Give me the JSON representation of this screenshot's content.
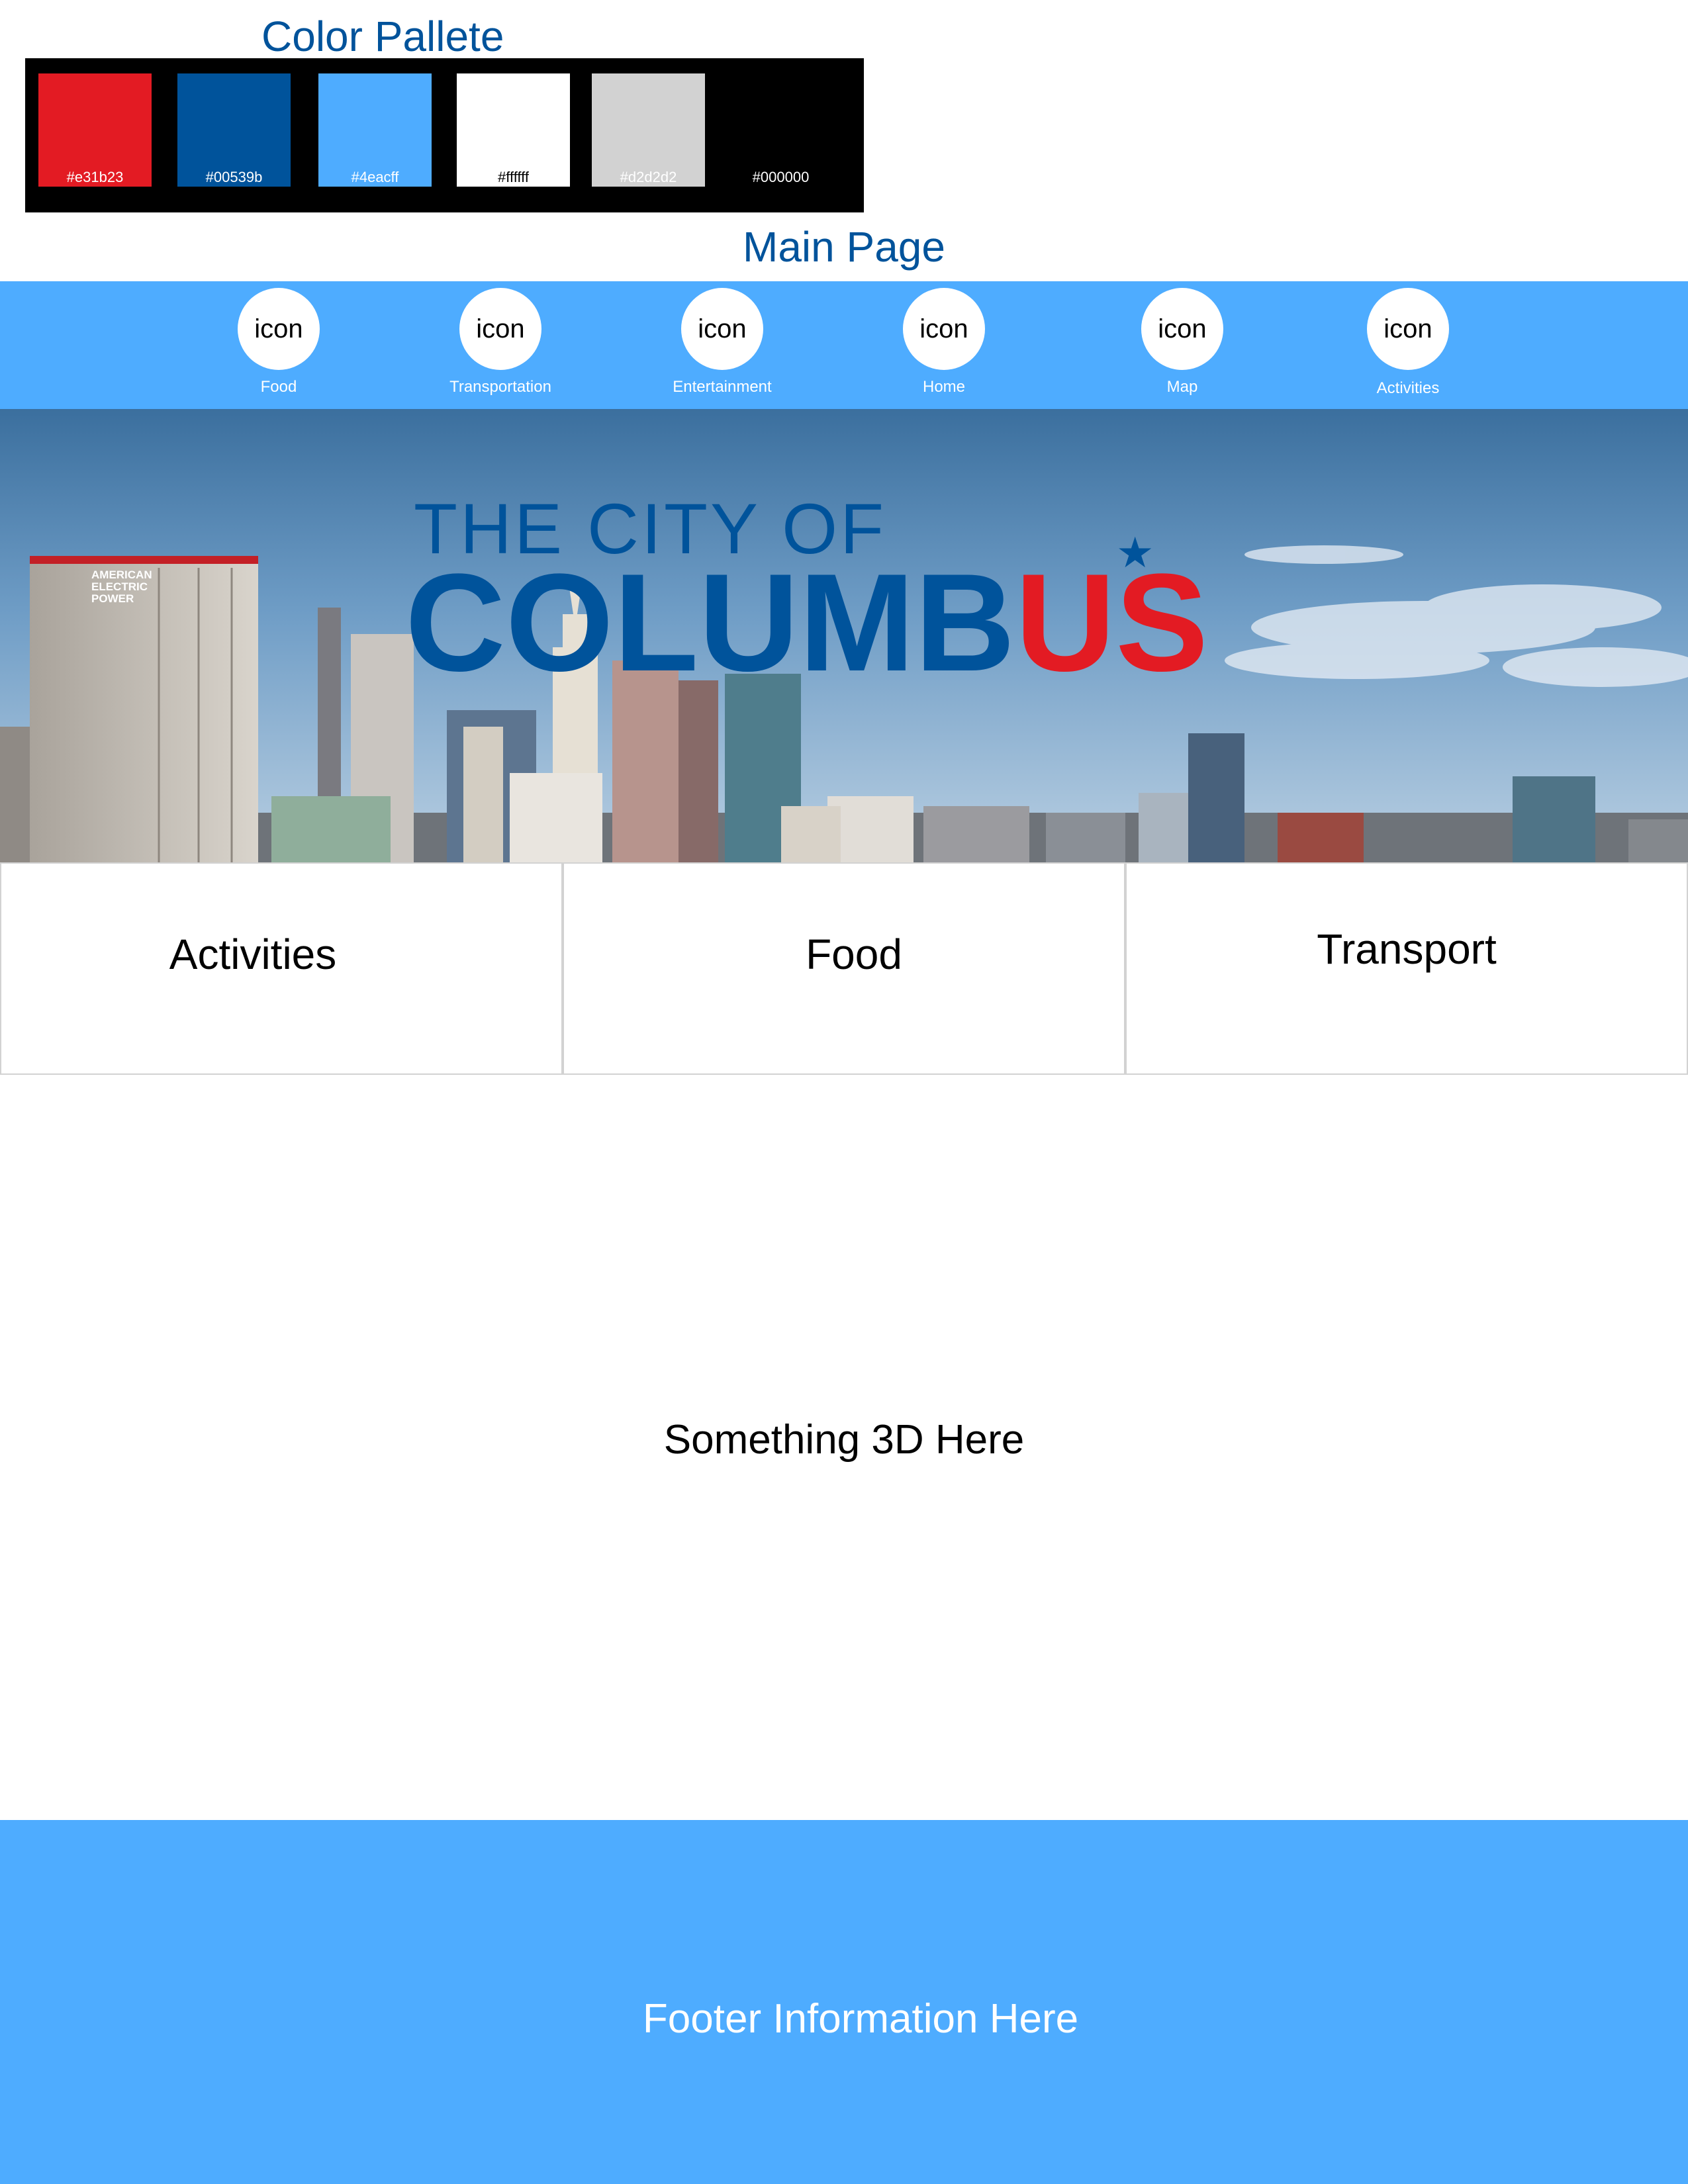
{
  "palette": {
    "title": "Color Pallete",
    "swatches": [
      {
        "hex": "#e31b23",
        "label": "#e31b23",
        "text_color": "#ffffff"
      },
      {
        "hex": "#00539b",
        "label": "#00539b",
        "text_color": "#ffffff"
      },
      {
        "hex": "#4eacff",
        "label": "#4eacff",
        "text_color": "#ffffff"
      },
      {
        "hex": "#ffffff",
        "label": "#ffffff",
        "text_color": "#000000"
      },
      {
        "hex": "#d2d2d2",
        "label": "#d2d2d2",
        "text_color": "#ffffff"
      },
      {
        "hex": "#000000",
        "label": "#000000",
        "text_color": "#ffffff"
      }
    ]
  },
  "main_title": "Main Page",
  "nav": {
    "items": [
      {
        "icon_text": "icon",
        "label": "Food"
      },
      {
        "icon_text": "icon",
        "label": "Transportation"
      },
      {
        "icon_text": "icon",
        "label": "Entertainment"
      },
      {
        "icon_text": "icon",
        "label": "Home"
      },
      {
        "icon_text": "icon",
        "label": "Map"
      },
      {
        "icon_text": "icon",
        "label": "Activities"
      }
    ]
  },
  "hero": {
    "line1": "THE CITY OF",
    "word_blue": "COLUMB",
    "word_red": "US",
    "building_sign": "AMERICAN ELECTRIC POWER"
  },
  "cards": [
    {
      "label": "Activities"
    },
    {
      "label": "Food"
    },
    {
      "label": "Transport"
    }
  ],
  "placeholder_3d": "Something 3D Here",
  "footer": {
    "text": "Footer Information Here"
  },
  "colors": {
    "red": "#e31b23",
    "dark_blue": "#00539b",
    "light_blue": "#4eacff",
    "white": "#ffffff",
    "gray": "#d2d2d2",
    "black": "#000000"
  }
}
